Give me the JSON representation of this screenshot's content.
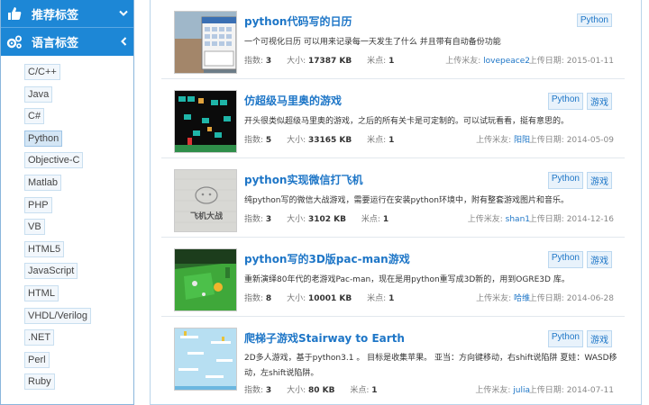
{
  "sidebar": {
    "sections": [
      {
        "label": "推荐标签",
        "icon": "thumbs-up-icon",
        "chevron": "chevron-down-icon"
      },
      {
        "label": "语言标签",
        "icon": "gears-icon",
        "chevron": "chevron-left-icon"
      }
    ],
    "tags": [
      "C/C++",
      "Java",
      "C#",
      "Python",
      "Objective-C",
      "Matlab",
      "PHP",
      "VB",
      "HTML5",
      "JavaScript",
      "HTML",
      "VHDL/Verilog",
      ".NET",
      "Perl",
      "Ruby"
    ],
    "active_tag": "Python"
  },
  "items": [
    {
      "title": "python代码写的日历",
      "desc": "一个可视化日历 可以用来记录每一天发生了什么 并且带有自动备份功能",
      "index_label": "指数:",
      "index": "3",
      "size_label": "大小:",
      "size": "17387 KB",
      "points_label": "米点:",
      "points": "1",
      "uploader_label": "上传米友:",
      "uploader": "lovepeace2",
      "date_label": "上传日期:",
      "date": "2015-01-11",
      "badges": [
        "Python"
      ]
    },
    {
      "title": "仿超级马里奥的游戏",
      "desc": "开头很类似超级马里奥的游戏，之后的所有关卡是可定制的。可以试玩看看，挺有意思的。",
      "index_label": "指数:",
      "index": "5",
      "size_label": "大小:",
      "size": "33165 KB",
      "points_label": "米点:",
      "points": "1",
      "uploader_label": "上传米友:",
      "uploader": "阳阳",
      "date_label": "上传日期:",
      "date": "2014-05-09",
      "badges": [
        "Python",
        "游戏"
      ]
    },
    {
      "title": "python实现微信打飞机",
      "desc": "纯python写的微信大战游戏，需要运行在安装python环境中，附有整套游戏图片和音乐。",
      "index_label": "指数:",
      "index": "3",
      "size_label": "大小:",
      "size": "3102 KB",
      "points_label": "米点:",
      "points": "1",
      "uploader_label": "上传米友:",
      "uploader": "shan1",
      "date_label": "上传日期:",
      "date": "2014-12-16",
      "badges": [
        "Python",
        "游戏"
      ]
    },
    {
      "title": "python写的3D版pac-man游戏",
      "desc": "重新演绎80年代的老游戏Pac-man，现在是用python重写成3D新的，用到OGRE3D 库。",
      "index_label": "指数:",
      "index": "8",
      "size_label": "大小:",
      "size": "10001 KB",
      "points_label": "米点:",
      "points": "1",
      "uploader_label": "上传米友:",
      "uploader": "哈维",
      "date_label": "上传日期:",
      "date": "2014-06-28",
      "badges": [
        "Python",
        "游戏"
      ]
    },
    {
      "title": "爬梯子游戏Stairway to Earth",
      "desc": "2D多人游戏，基于python3.1 。 目标是收集苹果。 亚当：方向键移动，右shift说陷阱 夏娃：WASD移动，左shift说陷阱。",
      "index_label": "指数:",
      "index": "3",
      "size_label": "大小:",
      "size": "80 KB",
      "points_label": "米点:",
      "points": "1",
      "uploader_label": "上传米友:",
      "uploader": "julia",
      "date_label": "上传日期:",
      "date": "2014-07-11",
      "badges": [
        "Python",
        "游戏"
      ]
    }
  ],
  "thumb_text": "飞机大战"
}
